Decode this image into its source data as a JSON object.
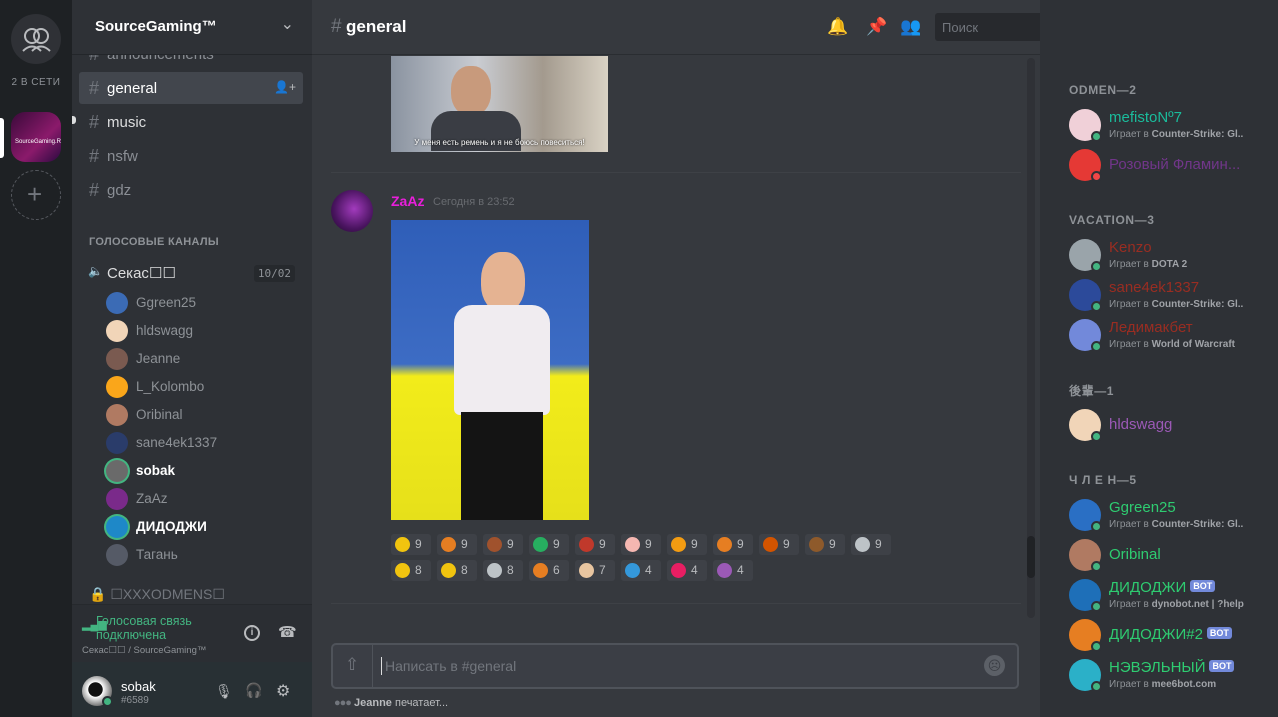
{
  "guilds": {
    "online_label": "2 В СЕТИ"
  },
  "server": {
    "name": "SourceGaming™"
  },
  "channels": [
    {
      "name": "announcements"
    },
    {
      "name": "general",
      "active": true
    },
    {
      "name": "music"
    },
    {
      "name": "nsfw"
    },
    {
      "name": "gdz"
    }
  ],
  "voice": {
    "category": "ГОЛОСОВЫЕ КАНАЛЫ",
    "channel": "Секас☐☐",
    "count": "10/02",
    "users": [
      "Ggreen25",
      "hldswagg",
      "Jeanne",
      "L_Kolombo",
      "Oribinal",
      "sane4ek1337",
      "sobak",
      "ZaAz",
      "ДИДОДЖИ",
      "Тагань"
    ],
    "locked_channel": "☐XXXODMENS☐"
  },
  "voicebar": {
    "status": "Голосовая связь подключена",
    "location": "Секас☐☐ / SourceGaming™"
  },
  "user": {
    "name": "sobak",
    "tag": "#6589"
  },
  "header": {
    "channel": "general",
    "search_placeholder": "Поиск"
  },
  "messages": {
    "caption": "У меня есть ремень и я не боюсь повеситься!",
    "author": "ZaAz",
    "timestamp": "Сегодня в 23:52",
    "reactions_row1": [
      "9",
      "9",
      "9",
      "9",
      "9",
      "9",
      "9",
      "9",
      "9",
      "9",
      "9"
    ],
    "reactions_row2": [
      "8",
      "8",
      "8",
      "6",
      "7",
      "4",
      "4",
      "4"
    ]
  },
  "composer": {
    "placeholder": "Написать в #general"
  },
  "typing": {
    "user": "Jeanne",
    "text": "печатает..."
  },
  "members": {
    "cat1": "ODMEN—2",
    "cat2": "VACATION—3",
    "cat3": "後輩—1",
    "cat4": "Ч Л Е Н—5",
    "playing": "Играет в",
    "list": [
      {
        "name": "mefistoNº7",
        "game": "Counter-Strike: Gl...",
        "color": "#1abc9c"
      },
      {
        "name": "Розовый Фламин...",
        "game": "",
        "color": "#71368a"
      },
      {
        "name": "Kenzo",
        "game": "DOTA 2",
        "color": "#992d22"
      },
      {
        "name": "sane4ek1337",
        "game": "Counter-Strike: Gl...",
        "color": "#992d22"
      },
      {
        "name": "Ледимакбет",
        "game": "World of Warcraft",
        "color": "#992d22"
      },
      {
        "name": "hldswagg",
        "game": "",
        "color": "#9b59b6"
      },
      {
        "name": "Ggreen25",
        "game": "Counter-Strike: Gl...",
        "color": "#2ecc71"
      },
      {
        "name": "Oribinal",
        "game": "",
        "color": "#2ecc71"
      },
      {
        "name": "ДИДОДЖИ",
        "game": "dynobot.net | ?help",
        "color": "#2ecc71",
        "bot": "BOT"
      },
      {
        "name": "ДИДОДЖИ#2",
        "game": "",
        "color": "#2ecc71",
        "bot": "BOT"
      },
      {
        "name": "НЭВЭЛЬНЫЙ",
        "game": "mee6bot.com",
        "color": "#2ecc71",
        "bot": "BOT"
      }
    ]
  }
}
